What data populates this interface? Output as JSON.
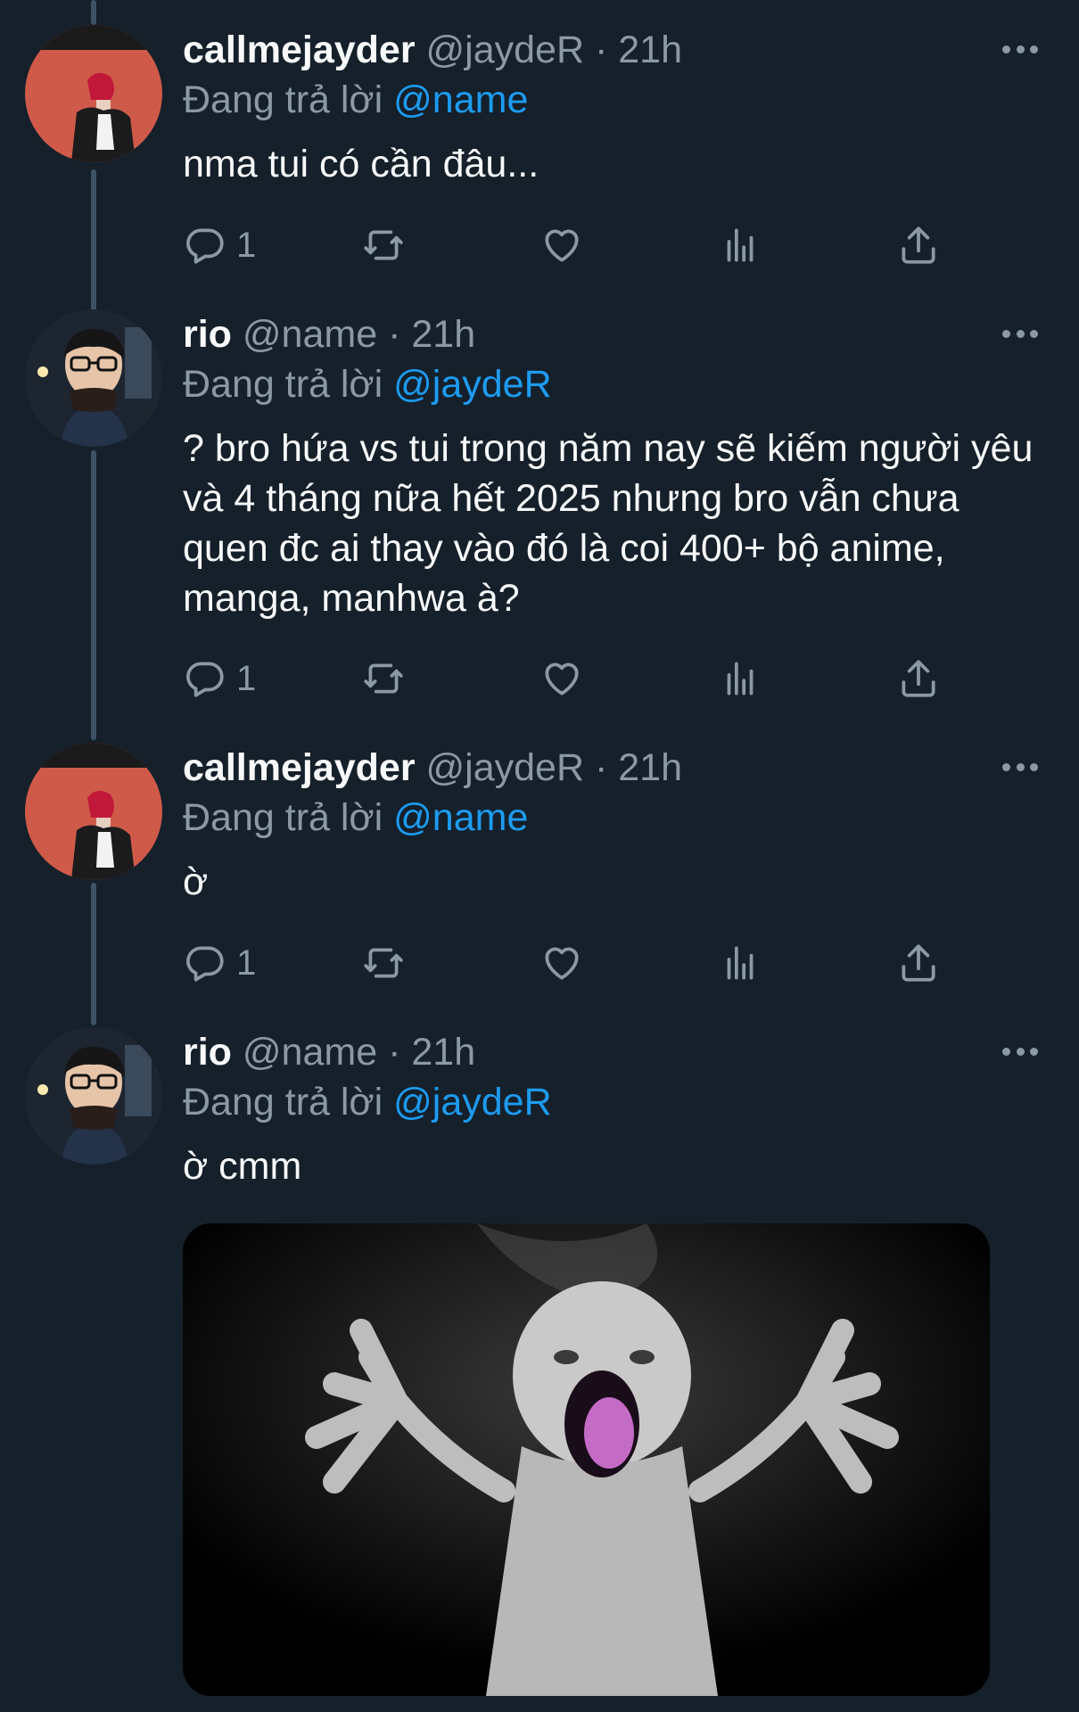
{
  "tweets": [
    {
      "display_name": "callmejayder",
      "handle": "@jaydeR",
      "time": "21h",
      "reply_prefix": "Đang trả lời",
      "reply_to": "@name",
      "text": "nma tui có cần đâu...",
      "reply_count": "1",
      "avatar": "avatar-callmejayder"
    },
    {
      "display_name": "rio",
      "handle": "@name",
      "time": "21h",
      "reply_prefix": "Đang trả lời",
      "reply_to": "@jaydeR",
      "text": "? bro hứa vs tui trong năm nay sẽ kiếm người yêu và 4 tháng nữa hết 2025 nhưng bro vẫn chưa quen đc ai thay vào đó là coi 400+ bộ anime, manga, manhwa à?",
      "reply_count": "1",
      "avatar": "avatar-rio"
    },
    {
      "display_name": "callmejayder",
      "handle": "@jaydeR",
      "time": "21h",
      "reply_prefix": "Đang trả lời",
      "reply_to": "@name",
      "text": "ờ",
      "reply_count": "1",
      "avatar": "avatar-callmejayder"
    },
    {
      "display_name": "rio",
      "handle": "@name",
      "time": "21h",
      "reply_prefix": "Đang trả lời",
      "reply_to": "@jaydeR",
      "text": "ờ cmm",
      "media": "screaming-baby-image",
      "avatar": "avatar-rio"
    }
  ],
  "separator": "·",
  "icons": {
    "reply": "reply-icon",
    "retweet": "retweet-icon",
    "like": "heart-icon",
    "views": "views-icon",
    "share": "share-icon",
    "more": "more-icon"
  },
  "colors": {
    "background": "#15202b",
    "text_primary": "#f7f9f9",
    "text_secondary": "#8b98a5",
    "accent": "#1d9bf0",
    "thread_line": "#3d5466"
  }
}
